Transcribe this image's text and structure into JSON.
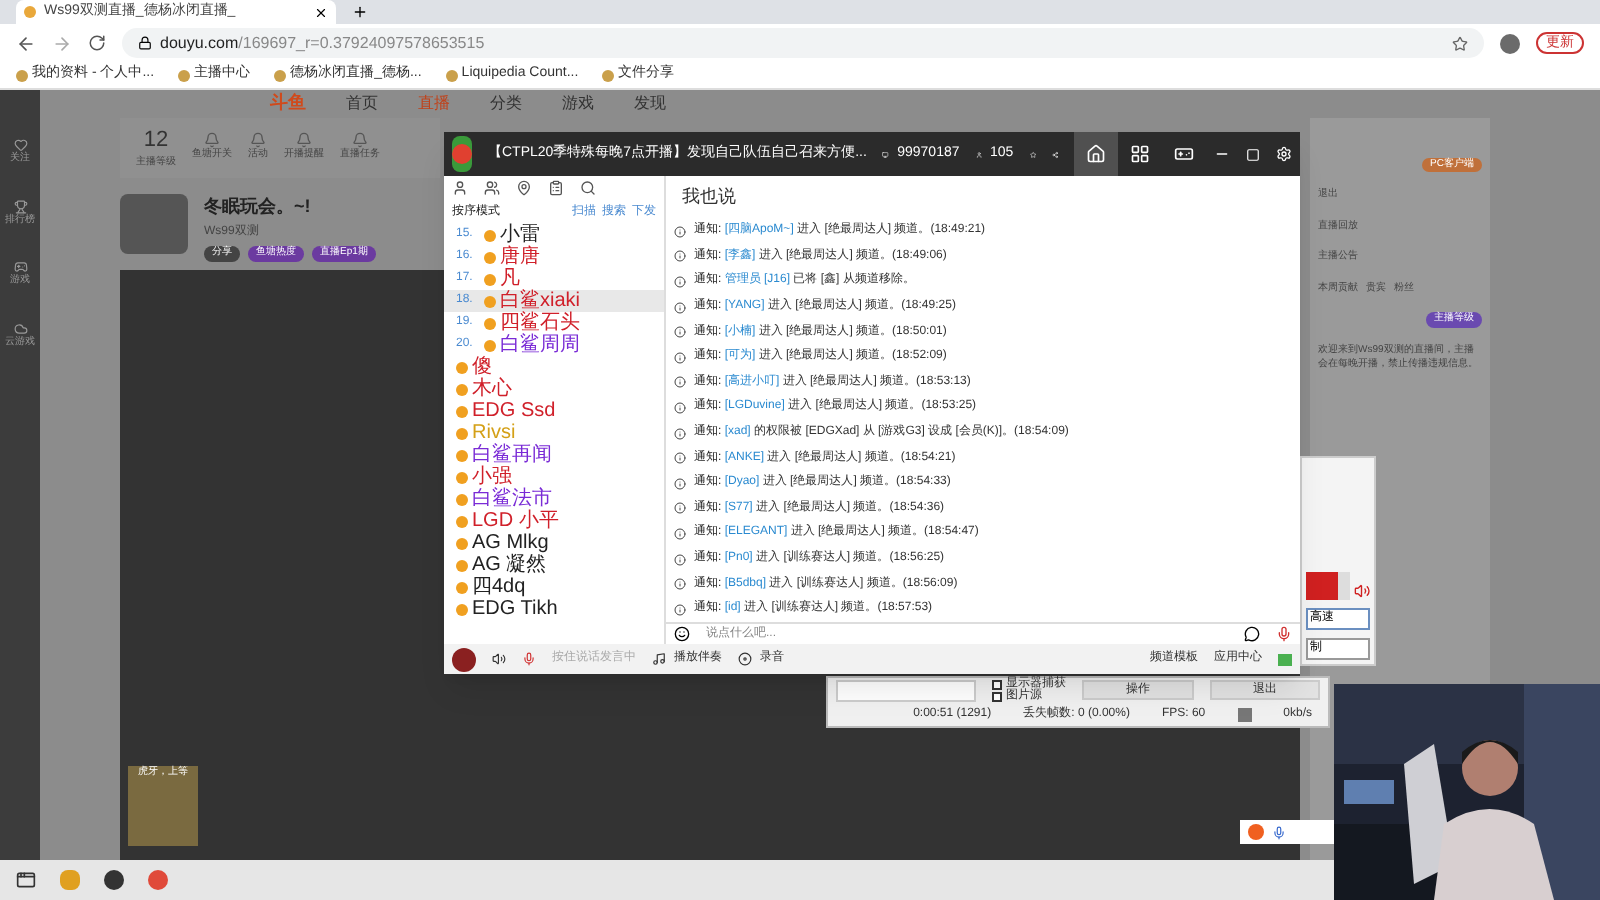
{
  "browser": {
    "tab_title": "Ws99双测直播_德杨冰闭直播_",
    "url_host": "douyu.com",
    "url_path": "/169697_r=0.37924097578653515",
    "bookmarks": [
      "我的资料 - 个人中...",
      "主播中心",
      "德杨冰闭直播_德杨...",
      "Liquipedia Count...",
      "文件分享"
    ],
    "menu_label": "更新"
  },
  "site": {
    "logo": "斗鱼",
    "nav": [
      {
        "label": "首页",
        "selected": false
      },
      {
        "label": "直播",
        "selected": true
      },
      {
        "label": "分类",
        "selected": false
      },
      {
        "label": "游戏",
        "selected": false
      },
      {
        "label": "发现",
        "selected": false
      }
    ],
    "sidebar": [
      "关注",
      "排行榜",
      "游戏",
      "云游戏"
    ],
    "stats": [
      {
        "value": "12",
        "label": "主播等级"
      },
      {
        "label": "鱼塘开关"
      },
      {
        "label": "活动"
      },
      {
        "label": "开播提醒"
      },
      {
        "label": "直播任务"
      }
    ],
    "streamer": {
      "title": "冬眠玩会。~!",
      "category": "Ws99双测",
      "tags": [
        "分享",
        "鱼塘热度",
        "直播Ep1期"
      ]
    },
    "right": {
      "pc_button": "PC客户端",
      "follow": "退出",
      "replay": "直播回放",
      "notice": "主播公告",
      "tabs": [
        "本周贡献",
        "贵宾",
        "粉丝"
      ],
      "note": "欢迎来到Ws99双测的直播间，主播会在每晚开播，禁止传播违规信息。",
      "badge_text": "主播等级"
    },
    "promo": "虎牙，上等"
  },
  "yy": {
    "title": "【CTPL20季特殊每晚7点开播】发现自己队伍自己召来方便...",
    "channel_id": "99970187",
    "online": "105",
    "nav": [
      {
        "selected": true
      },
      {
        "selected": false
      },
      {
        "selected": false
      }
    ],
    "mode": "按序模式",
    "links": [
      "扫描",
      "搜索",
      "下发"
    ],
    "users": [
      {
        "num": "15.",
        "name": "小雷",
        "color": "#222222",
        "hover": false
      },
      {
        "num": "16.",
        "name": "唐唐",
        "color": "#d0202a",
        "hover": false
      },
      {
        "num": "17.",
        "name": "凡",
        "color": "#d0202a",
        "hover": false
      },
      {
        "num": "18.",
        "name": "白鲨xiaki",
        "color": "#d0202a",
        "hover": true
      },
      {
        "num": "19.",
        "name": "四鲨石头",
        "color": "#d0202a",
        "hover": false
      },
      {
        "num": "20.",
        "name": "白鲨周周",
        "color": "#7a2bd6",
        "hover": false
      },
      {
        "name": "傻",
        "color": "#d0202a",
        "hover": false
      },
      {
        "name": "木心",
        "color": "#d0202a",
        "hover": false
      },
      {
        "name": "EDG Ssd",
        "color": "#d0202a",
        "hover": false
      },
      {
        "name": "Rivsi",
        "color": "#d4a017",
        "hover": false
      },
      {
        "name": "白鲨再闻",
        "color": "#7a2bd6",
        "hover": false
      },
      {
        "name": "小强",
        "color": "#d0202a",
        "hover": false
      },
      {
        "name": "白鲨法市",
        "color": "#7a2bd6",
        "hover": false
      },
      {
        "name": "LGD 小平",
        "color": "#d0202a",
        "hover": false
      },
      {
        "name": "AG Mlkg",
        "color": "#222222",
        "hover": false
      },
      {
        "name": "AG 凝然",
        "color": "#222222",
        "hover": false
      },
      {
        "name": "四4dq",
        "color": "#222222",
        "hover": false
      },
      {
        "name": "EDG Tikh",
        "color": "#222222",
        "hover": false
      }
    ],
    "chat_title": "我也说",
    "messages": [
      {
        "label": "通知:",
        "user": "[四脑ApoM~]",
        "rest": "进入 [绝最周达人] 频道。(18:49:21)"
      },
      {
        "label": "通知:",
        "user": "[李鑫]",
        "rest": "进入 [绝最周达人] 频道。(18:49:06)"
      },
      {
        "label": "通知:",
        "user": "管理员 [J16]",
        "rest": "已将 [鑫] 从频道移除。"
      },
      {
        "label": "通知:",
        "user": "[YANG]",
        "rest": "进入 [绝最周达人] 频道。(18:49:25)"
      },
      {
        "label": "通知:",
        "user": "[小楠]",
        "rest": "进入 [绝最周达人] 频道。(18:50:01)"
      },
      {
        "label": "通知:",
        "user": "[可为]",
        "rest": "进入 [绝最周达人] 频道。(18:52:09)"
      },
      {
        "label": "通知:",
        "user": "[高进小叮]",
        "rest": "进入 [绝最周达人] 频道。(18:53:13)"
      },
      {
        "label": "通知:",
        "user": "[LGDuvine]",
        "rest": "进入 [绝最周达人] 频道。(18:53:25)"
      },
      {
        "label": "通知:",
        "user": "[xad]",
        "rest": "的权限被 [EDGXad] 从 [游戏G3] 设成 [会员(K)]。(18:54:09)"
      },
      {
        "label": "通知:",
        "user": "[ANKE]",
        "rest": "进入 [绝最周达人] 频道。(18:54:21)"
      },
      {
        "label": "通知:",
        "user": "[Dyao]",
        "rest": "进入 [绝最周达人] 频道。(18:54:33)"
      },
      {
        "label": "通知:",
        "user": "[S77]",
        "rest": "进入 [绝最周达人] 频道。(18:54:36)"
      },
      {
        "label": "通知:",
        "user": "[ELEGANT]",
        "rest": "进入 [绝最周达人] 频道。(18:54:47)"
      },
      {
        "label": "通知:",
        "user": "[Pn0]",
        "rest": "进入 [训练赛达人] 频道。(18:56:25)"
      },
      {
        "label": "通知:",
        "user": "[B5dbq]",
        "rest": "进入 [训练赛达人] 频道。(18:56:09)"
      },
      {
        "label": "通知:",
        "user": "[id]",
        "rest": "进入 [训练赛达人] 频道。(18:57:53)"
      }
    ],
    "input": {
      "placeholder": "说点什么吧..."
    },
    "bottom": {
      "hint": "按住说话发言中",
      "music": "播放伴奏",
      "record": "录音",
      "template": "频道模板",
      "apps": "应用中心"
    }
  },
  "obs": {
    "sources": [
      {
        "label": "显示器捕获",
        "checked": false
      },
      {
        "label": "图片源",
        "checked": false
      }
    ],
    "buttons": [
      "操作",
      "退出"
    ],
    "time": "0:00:51 (1291)",
    "dropped": "丢失帧数: 0 (0.00%)",
    "fps": "FPS: 60",
    "rate": "0kb/s"
  },
  "mixer": {
    "level": 0.75,
    "field": "高速",
    "select": "制"
  }
}
